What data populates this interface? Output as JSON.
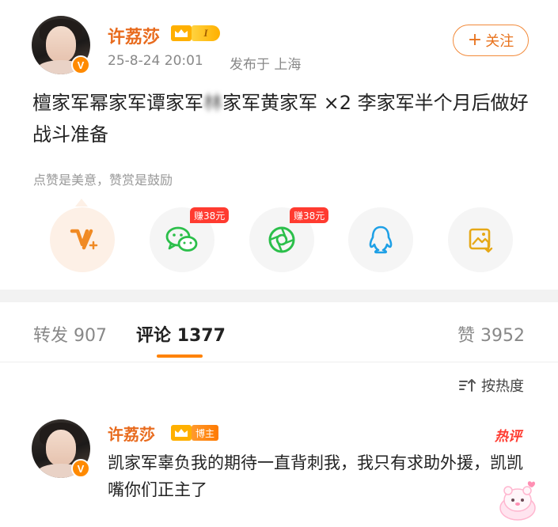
{
  "post": {
    "author": "许荔莎",
    "level": "I",
    "time": "25-8-24 20:01",
    "source": "发布于 上海",
    "follow_label": "关注",
    "follow_plus": "+",
    "text_part1": "檀家军幂家军谭家军",
    "text_blurred": "林",
    "text_part2": "家军黄家军 ×2 李家军半个月后做好战斗准备",
    "reward_hint": "点赞是美意，赞赏是鼓励",
    "earn_badge_1": "赚38元",
    "earn_badge_2": "赚38元"
  },
  "tabs": {
    "repost_label": "转发",
    "repost_count": "907",
    "comment_label": "评论",
    "comment_count": "1377",
    "like_label": "赞",
    "like_count": "3952"
  },
  "sort_label": "按热度",
  "comment": {
    "author": "许荔莎",
    "badge": "博主",
    "hot_label": "热评",
    "text": "凯家军辜负我的期待一直背刺我，我只有求助外援，凯凯嘴你们正主了"
  },
  "colors": {
    "accent": "#ff8200",
    "name": "#e86b1e",
    "badge_red": "#ff3b30"
  },
  "icons": [
    "v-plus-icon",
    "wechat-icon",
    "moments-icon",
    "qq-icon",
    "save-image-icon",
    "crown-icon",
    "sort-icon",
    "sticker-icon"
  ]
}
